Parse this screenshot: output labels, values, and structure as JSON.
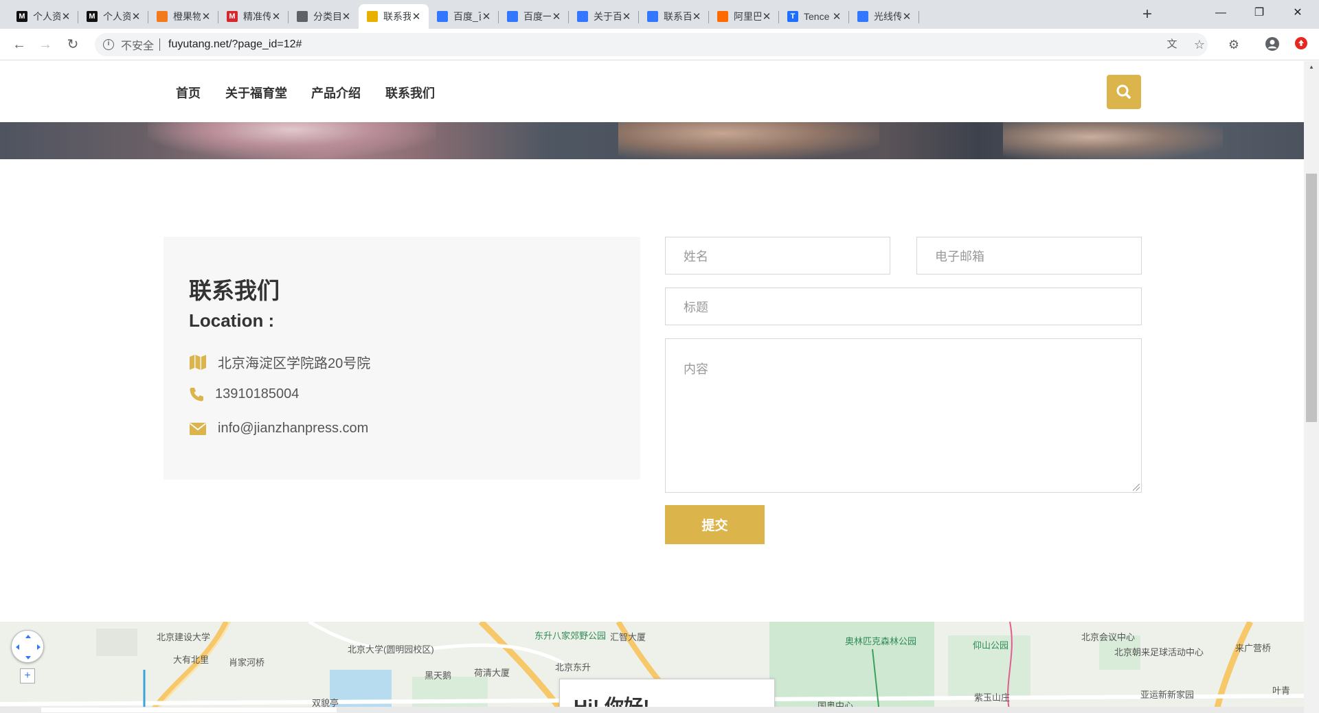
{
  "browser": {
    "tabs": [
      {
        "title": "个人资",
        "favicon": "M",
        "fav_color": "#111111"
      },
      {
        "title": "个人资",
        "favicon": "M",
        "fav_color": "#111111"
      },
      {
        "title": "橙果物",
        "favicon": "",
        "fav_color": "#f27a1a"
      },
      {
        "title": "精准传",
        "favicon": "M",
        "fav_color": "#d9262c"
      },
      {
        "title": "分类目",
        "favicon": "",
        "fav_color": "#5f6368"
      },
      {
        "title": "联系我",
        "favicon": "",
        "fav_color": "#e8b000"
      },
      {
        "title": "百度_百",
        "favicon": "",
        "fav_color": "#3377ff"
      },
      {
        "title": "百度一",
        "favicon": "",
        "fav_color": "#3377ff"
      },
      {
        "title": "关于百",
        "favicon": "",
        "fav_color": "#3377ff"
      },
      {
        "title": "联系百",
        "favicon": "",
        "fav_color": "#3377ff"
      },
      {
        "title": "阿里巴",
        "favicon": "",
        "fav_color": "#ff6a00"
      },
      {
        "title": "Tence",
        "favicon": "T",
        "fav_color": "#1e6fff"
      },
      {
        "title": "光线传",
        "favicon": "",
        "fav_color": "#3377ff"
      }
    ],
    "active_tab_index": 5,
    "address_bar": {
      "security_label": "不安全",
      "url": "fuyutang.net/?page_id=12#"
    }
  },
  "site": {
    "nav": [
      "首页",
      "关于福育堂",
      "产品介绍",
      "联系我们"
    ],
    "accent_color": "#dbb54c"
  },
  "contact": {
    "title": "联系我们",
    "location_label": "Location :",
    "address": "北京海淀区学院路20号院",
    "phone": "13910185004",
    "email": "info@jianzhanpress.com"
  },
  "form": {
    "name_placeholder": "姓名",
    "email_placeholder": "电子邮箱",
    "subject_placeholder": "标题",
    "message_placeholder": "内容",
    "submit_label": "提交"
  },
  "map": {
    "labels": [
      "北京建设大学",
      "大有北里",
      "肖家河桥",
      "北京大学(圆明园校区)",
      "黑天鹅",
      "荷清大厦",
      "东升八家郊野公园",
      "汇智大厦",
      "北京东升",
      "双貌亭",
      "奥林匹克森林公园",
      "仰山公园",
      "北京会议中心",
      "北京朝来足球活动中心",
      "来广营桥",
      "紫玉山庄",
      "亚运新新家园",
      "国奥中心",
      "叶青"
    ],
    "info_window_text": "Hi! 你好!"
  }
}
